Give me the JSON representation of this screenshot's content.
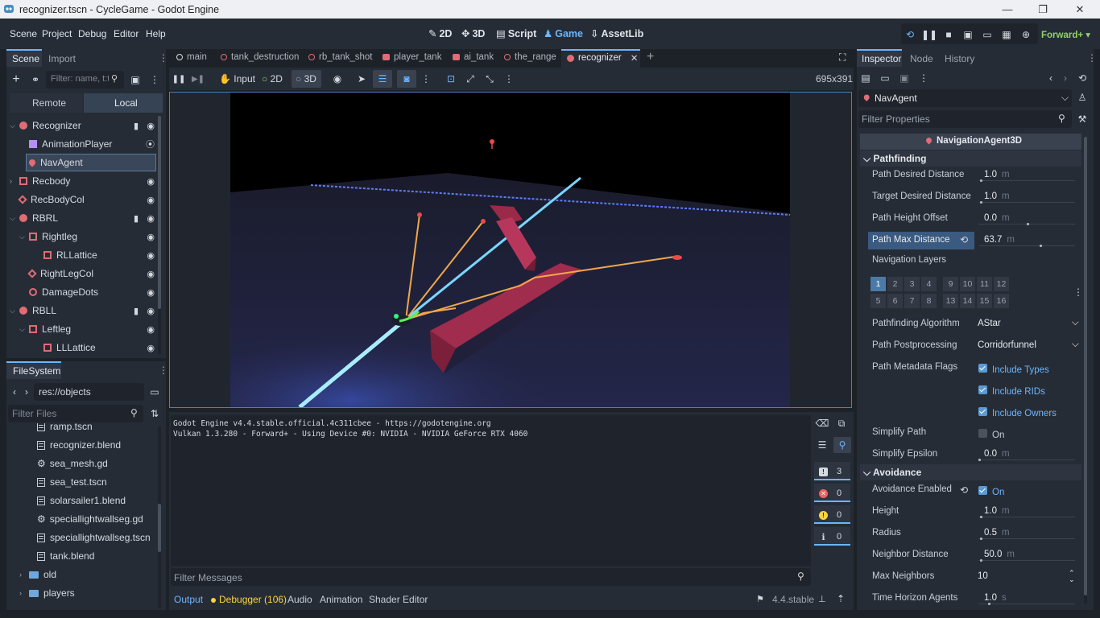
{
  "window": {
    "title": "recognizer.tscn - CycleGame - Godot Engine"
  },
  "menu": [
    "Scene",
    "Project",
    "Debug",
    "Editor",
    "Help"
  ],
  "workspaces": {
    "w2d": "2D",
    "w3d": "3D",
    "script": "Script",
    "game": "Game",
    "assetlib": "AssetLib",
    "renderer": "Forward+"
  },
  "scene_dock": {
    "tab": "Scene",
    "tab2": "Import",
    "filter_placeholder": "Filter: name, t:t",
    "remote": "Remote",
    "local": "Local",
    "nodes": [
      {
        "label": "Recognizer",
        "color": "#e06c75"
      },
      {
        "label": "AnimationPlayer",
        "color": "#b48ef2"
      },
      {
        "label": "NavAgent",
        "color": "#e06c75"
      },
      {
        "label": "Recbody",
        "color": "#e06c75"
      },
      {
        "label": "RecBodyCol",
        "color": "#e06c75"
      },
      {
        "label": "RBRL",
        "color": "#e06c75"
      },
      {
        "label": "Rightleg",
        "color": "#e06c75"
      },
      {
        "label": "RLLattice",
        "color": "#e06c75"
      },
      {
        "label": "RightLegCol",
        "color": "#e06c75"
      },
      {
        "label": "DamageDots",
        "color": "#e06c75"
      },
      {
        "label": "RBLL",
        "color": "#e06c75"
      },
      {
        "label": "Leftleg",
        "color": "#e06c75"
      },
      {
        "label": "LLLattice",
        "color": "#e06c75"
      }
    ]
  },
  "filesystem": {
    "tab": "FileSystem",
    "path": "res://objects",
    "filter_placeholder": "Filter Files",
    "files": [
      {
        "label": "ramp.tscn",
        "kind": "scene"
      },
      {
        "label": "recognizer.blend",
        "kind": "scene"
      },
      {
        "label": "sea_mesh.gd",
        "kind": "gear"
      },
      {
        "label": "sea_test.tscn",
        "kind": "scene"
      },
      {
        "label": "solarsailer1.blend",
        "kind": "scene"
      },
      {
        "label": "speciallightwallseg.gd",
        "kind": "gear"
      },
      {
        "label": "speciallightwallseg.tscn",
        "kind": "scene"
      },
      {
        "label": "tank.blend",
        "kind": "scene"
      },
      {
        "label": "old",
        "kind": "folder"
      },
      {
        "label": "players",
        "kind": "folder"
      }
    ]
  },
  "scene_tabs": [
    "main",
    "tank_destruction",
    "rb_tank_shot",
    "player_tank",
    "ai_tank",
    "the_range",
    "recognizer"
  ],
  "game_toolbar": {
    "input": "Input",
    "m2d": "2D",
    "m3d": "3D",
    "size": "695x391"
  },
  "output": {
    "lines": [
      "Godot Engine v4.4.stable.official.4c311cbee - https://godotengine.org",
      "Vulkan 1.3.280 - Forward+ - Using Device #0: NVIDIA - NVIDIA GeForce RTX 4060"
    ],
    "filter_placeholder": "Filter Messages",
    "counts": {
      "log": "3",
      "errors": "0",
      "warnings": "0",
      "info": "0"
    }
  },
  "bottom_tabs": {
    "output": "Output",
    "debugger": "Debugger (106)",
    "audio": "Audio",
    "animation": "Animation",
    "shader": "Shader Editor",
    "version": "4.4.stable"
  },
  "inspector": {
    "tabs": [
      "Inspector",
      "Node",
      "History"
    ],
    "node": "NavAgent",
    "filter_placeholder": "Filter Properties",
    "class": "NavigationAgent3D",
    "sections": {
      "pathfinding": "Pathfinding",
      "avoidance": "Avoidance"
    },
    "props": {
      "path_desired": {
        "label": "Path Desired Distance",
        "value": "1.0",
        "unit": "m",
        "level": 0.02
      },
      "target_desired": {
        "label": "Target Desired Distance",
        "value": "1.0",
        "unit": "m",
        "level": 0.02
      },
      "path_height": {
        "label": "Path Height Offset",
        "value": "0.0",
        "unit": "m",
        "level": 0.5
      },
      "path_max": {
        "label": "Path Max Distance",
        "value": "63.7",
        "unit": "m",
        "level": 0.63
      },
      "nav_layers": {
        "label": "Navigation Layers",
        "row1": [
          "1",
          "2",
          "3",
          "4",
          "9",
          "10",
          "11",
          "12"
        ],
        "row2": [
          "5",
          "6",
          "7",
          "8",
          "13",
          "14",
          "15",
          "16"
        ]
      },
      "algorithm": {
        "label": "Pathfinding Algorithm",
        "value": "AStar"
      },
      "postproc": {
        "label": "Path Postprocessing",
        "value": "Corridorfunnel"
      },
      "metadata": {
        "label": "Path Metadata Flags",
        "flags": [
          "Include Types",
          "Include RIDs",
          "Include Owners"
        ]
      },
      "simplify": {
        "label": "Simplify Path",
        "value": "On"
      },
      "epsilon": {
        "label": "Simplify Epsilon",
        "value": "0.0",
        "unit": "m",
        "level": 0.0
      },
      "avoid_enabled": {
        "label": "Avoidance Enabled",
        "value": "On"
      },
      "height": {
        "label": "Height",
        "value": "1.0",
        "unit": "m",
        "level": 0.02
      },
      "radius": {
        "label": "Radius",
        "value": "0.5",
        "unit": "m",
        "level": 0.02
      },
      "neighbor": {
        "label": "Neighbor Distance",
        "value": "50.0",
        "unit": "m",
        "level": 0.02
      },
      "max_neighbors": {
        "label": "Max Neighbors",
        "value": "10"
      },
      "horizon": {
        "label": "Time Horizon Agents",
        "value": "1.0",
        "unit": "s",
        "level": 0.1
      }
    }
  }
}
